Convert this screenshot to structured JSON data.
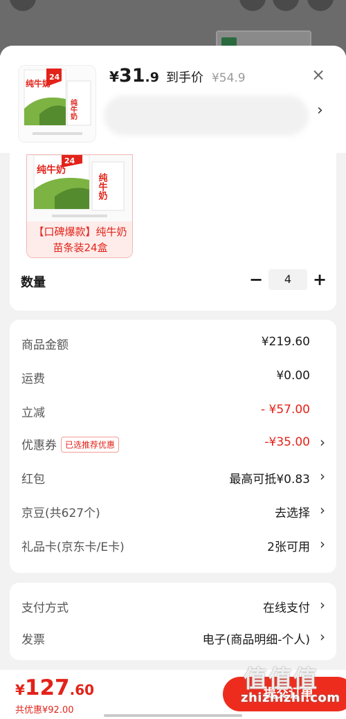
{
  "product": {
    "price_symbol": "¥",
    "price_int": "31",
    "price_dec": ".9",
    "price_tag": "到手价",
    "original_price": "¥54.9",
    "thumb_badge": "24",
    "thumb_brand": "纯牛奶",
    "thumb_side": "纯牛奶"
  },
  "variant": {
    "label": "【口碑爆款】纯牛奶苗条装24盒",
    "badge": "24",
    "brand": "纯牛奶",
    "side": "纯牛奶"
  },
  "quantity": {
    "title": "数量",
    "minus": "−",
    "value": "4",
    "plus": "+"
  },
  "fees": [
    {
      "label": "商品金额",
      "value": "¥219.60",
      "red": false,
      "arrow": false
    },
    {
      "label": "运费",
      "value": "¥0.00",
      "red": false,
      "arrow": false
    },
    {
      "label": "立减",
      "value": "- ¥57.00",
      "red": true,
      "arrow": false
    },
    {
      "label": "优惠券",
      "badge": "已选推荐优惠",
      "value": "-¥35.00",
      "red": true,
      "arrow": true
    },
    {
      "label": "红包",
      "value": "最高可抵¥0.83",
      "red": false,
      "arrow": true
    },
    {
      "label": "京豆(共627个)",
      "value": "去选择",
      "red": false,
      "arrow": true
    },
    {
      "label": "礼品卡(京东卡/E卡)",
      "value": "2张可用",
      "red": false,
      "arrow": true
    }
  ],
  "payment": {
    "method_label": "支付方式",
    "method_value": "在线支付",
    "invoice_label": "发票",
    "invoice_value": "电子(商品明细-个人)"
  },
  "footer": {
    "total_symbol": "¥",
    "total_int": "127",
    "total_dec": ".60",
    "saved": "共优惠¥92.00",
    "submit": "提交订单"
  },
  "watermark": {
    "text": "zhizhizhi.com",
    "cn": "值值值"
  },
  "icons": {
    "close": "close-icon",
    "chevron": "chevron-right-icon"
  },
  "colors": {
    "accent": "#e2231a",
    "submit_bg": "#ee2c1e"
  }
}
